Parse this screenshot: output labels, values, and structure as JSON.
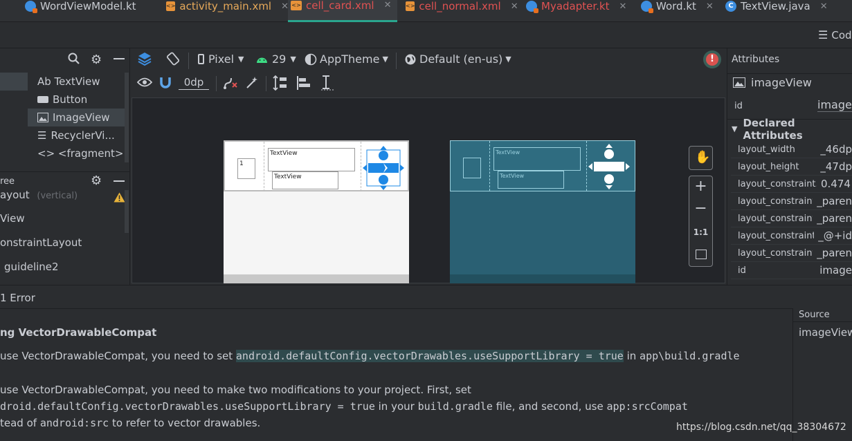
{
  "tabs": [
    {
      "label": "WordViewModel.kt",
      "icon": "kotlin-file-icon",
      "active": false
    },
    {
      "label": "activity_main.xml",
      "icon": "xml-file-icon",
      "active": false
    },
    {
      "label": "cell_card.xml",
      "icon": "xml-file-icon",
      "active": true
    },
    {
      "label": "cell_normal.xml",
      "icon": "xml-file-icon",
      "active": false
    },
    {
      "label": "Myadapter.kt",
      "icon": "kotlin-file-icon",
      "active": false
    },
    {
      "label": "Word.kt",
      "icon": "kotlin-file-icon",
      "active": false
    },
    {
      "label": "TextView.java",
      "icon": "java-file-icon",
      "active": false
    }
  ],
  "code_view_label": "Cod",
  "toolbar": {
    "device": "Pixel",
    "api": "29",
    "theme": "AppTheme",
    "locale": "Default (en-us)",
    "margin": "0dp"
  },
  "palette": {
    "items": [
      {
        "label": "Ab TextView"
      },
      {
        "label": "Button"
      },
      {
        "label": "ImageView"
      },
      {
        "label": "RecyclerVi..."
      },
      {
        "label": "<> <fragment>"
      }
    ],
    "selected_index": 2
  },
  "tree": {
    "header": "ree",
    "items": [
      "ayout",
      "View",
      "onstraintLayout",
      "guideline2"
    ],
    "layout_suffix": "(vertical)"
  },
  "preview": {
    "text1": "TextView",
    "text2": "TextView",
    "small": "1",
    "blue_text1": "TextView",
    "blue_text2": "TextView"
  },
  "attributes": {
    "title": "Attributes",
    "component": "imageView",
    "id_label": "id",
    "id_value": "image",
    "section": "Declared Attributes",
    "rows": [
      {
        "key": "layout_width",
        "value": "_46dp"
      },
      {
        "key": "layout_height",
        "value": "_47dp"
      },
      {
        "key": "layout_constraint...",
        "value": "0.474"
      },
      {
        "key": "layout_constraint...",
        "value": "_paren"
      },
      {
        "key": "layout_constraint...",
        "value": "_paren"
      },
      {
        "key": "layout_constraint...",
        "value": "_@+id"
      },
      {
        "key": "layout_constraint...",
        "value": "_paren"
      },
      {
        "key": "id",
        "value": "image"
      }
    ]
  },
  "errors": {
    "summary": "1 Error",
    "title": "ng VectorDrawableCompat",
    "line1_prefix": " use VectorDrawableCompat, you need to set ",
    "line1_code": "android.defaultConfig.vectorDrawables.useSupportLibrary = true",
    "line1_mid": " in ",
    "line1_path": "app\\build.gradle",
    "line2": " use VectorDrawableCompat, you need to make two modifications to your project. First, set",
    "line3_code": "droid.defaultConfig.vectorDrawables.useSupportLibrary = true",
    "line3_mid": " in your ",
    "line3_code2": "build.gradle",
    "line3_mid2": " file, and second, use ",
    "line3_code3": "app:srcCompat",
    "line4_prefix": "tead of ",
    "line4_code": "android:src",
    "line4_suffix": " to refer to vector drawables."
  },
  "source": {
    "header": "Source",
    "value": "imageView"
  },
  "watermark": "https://blog.csdn.net/qq_38304672",
  "colors": {
    "accent": "#2aa58e",
    "error_tab": "#e05252",
    "blueprint": "#2a6073",
    "handle_blue": "#1e88e5"
  }
}
